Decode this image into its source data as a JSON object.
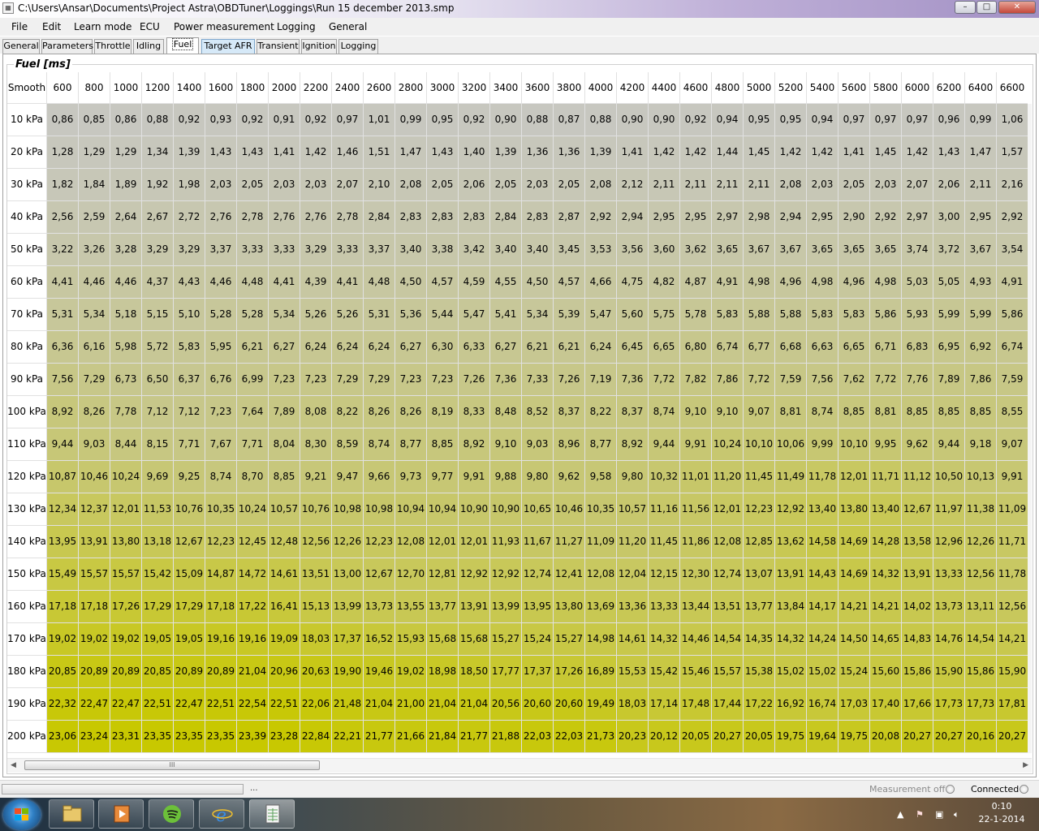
{
  "window": {
    "title": "C:\\Users\\Ansar\\Documents\\Project Astra\\OBDTuner\\Loggings\\Run 15 december 2013.smp",
    "min": "–",
    "max": "□",
    "close": "✕"
  },
  "menu": [
    "File",
    "Edit",
    "Learn mode",
    "ECU",
    "Power measurement",
    "Logging",
    "General"
  ],
  "tabs": [
    "General",
    "Parameters",
    "Throttle",
    "Idling",
    "Fuel",
    "Target AFR",
    "Transient",
    "Ignition",
    "Logging"
  ],
  "active_tab": "Fuel",
  "panel": {
    "title": "Fuel [ms]"
  },
  "table": {
    "corner": "Smooth",
    "columns": [
      "600",
      "800",
      "1000",
      "1200",
      "1400",
      "1600",
      "1800",
      "2000",
      "2200",
      "2400",
      "2600",
      "2800",
      "3000",
      "3200",
      "3400",
      "3600",
      "3800",
      "4000",
      "4200",
      "4400",
      "4600",
      "4800",
      "5000",
      "5200",
      "5400",
      "5600",
      "5800",
      "6000",
      "6200",
      "6400",
      "6600"
    ],
    "rows": [
      {
        "label": "10 kPa",
        "values": [
          "0,86",
          "0,85",
          "0,86",
          "0,88",
          "0,92",
          "0,93",
          "0,92",
          "0,91",
          "0,92",
          "0,97",
          "1,01",
          "0,99",
          "0,95",
          "0,92",
          "0,90",
          "0,88",
          "0,87",
          "0,88",
          "0,90",
          "0,90",
          "0,92",
          "0,94",
          "0,95",
          "0,95",
          "0,94",
          "0,97",
          "0,97",
          "0,97",
          "0,96",
          "0,99",
          "1,06"
        ]
      },
      {
        "label": "20 kPa",
        "values": [
          "1,28",
          "1,29",
          "1,29",
          "1,34",
          "1,39",
          "1,43",
          "1,43",
          "1,41",
          "1,42",
          "1,46",
          "1,51",
          "1,47",
          "1,43",
          "1,40",
          "1,39",
          "1,36",
          "1,36",
          "1,39",
          "1,41",
          "1,42",
          "1,42",
          "1,44",
          "1,45",
          "1,42",
          "1,42",
          "1,41",
          "1,45",
          "1,42",
          "1,43",
          "1,47",
          "1,57"
        ]
      },
      {
        "label": "30 kPa",
        "values": [
          "1,82",
          "1,84",
          "1,89",
          "1,92",
          "1,98",
          "2,03",
          "2,05",
          "2,03",
          "2,03",
          "2,07",
          "2,10",
          "2,08",
          "2,05",
          "2,06",
          "2,05",
          "2,03",
          "2,05",
          "2,08",
          "2,12",
          "2,11",
          "2,11",
          "2,11",
          "2,11",
          "2,08",
          "2,03",
          "2,05",
          "2,03",
          "2,07",
          "2,06",
          "2,11",
          "2,16"
        ]
      },
      {
        "label": "40 kPa",
        "values": [
          "2,56",
          "2,59",
          "2,64",
          "2,67",
          "2,72",
          "2,76",
          "2,78",
          "2,76",
          "2,76",
          "2,78",
          "2,84",
          "2,83",
          "2,83",
          "2,83",
          "2,84",
          "2,83",
          "2,87",
          "2,92",
          "2,94",
          "2,95",
          "2,95",
          "2,97",
          "2,98",
          "2,94",
          "2,95",
          "2,90",
          "2,92",
          "2,97",
          "3,00",
          "2,95",
          "2,92"
        ]
      },
      {
        "label": "50 kPa",
        "values": [
          "3,22",
          "3,26",
          "3,28",
          "3,29",
          "3,29",
          "3,37",
          "3,33",
          "3,33",
          "3,29",
          "3,33",
          "3,37",
          "3,40",
          "3,38",
          "3,42",
          "3,40",
          "3,40",
          "3,45",
          "3,53",
          "3,56",
          "3,60",
          "3,62",
          "3,65",
          "3,67",
          "3,67",
          "3,65",
          "3,65",
          "3,65",
          "3,74",
          "3,72",
          "3,67",
          "3,54"
        ]
      },
      {
        "label": "60 kPa",
        "values": [
          "4,41",
          "4,46",
          "4,46",
          "4,37",
          "4,43",
          "4,46",
          "4,48",
          "4,41",
          "4,39",
          "4,41",
          "4,48",
          "4,50",
          "4,57",
          "4,59",
          "4,55",
          "4,50",
          "4,57",
          "4,66",
          "4,75",
          "4,82",
          "4,87",
          "4,91",
          "4,98",
          "4,96",
          "4,98",
          "4,96",
          "4,98",
          "5,03",
          "5,05",
          "4,93",
          "4,91"
        ]
      },
      {
        "label": "70 kPa",
        "values": [
          "5,31",
          "5,34",
          "5,18",
          "5,15",
          "5,10",
          "5,28",
          "5,28",
          "5,34",
          "5,26",
          "5,26",
          "5,31",
          "5,36",
          "5,44",
          "5,47",
          "5,41",
          "5,34",
          "5,39",
          "5,47",
          "5,60",
          "5,75",
          "5,78",
          "5,83",
          "5,88",
          "5,88",
          "5,83",
          "5,83",
          "5,86",
          "5,93",
          "5,99",
          "5,99",
          "5,86"
        ]
      },
      {
        "label": "80 kPa",
        "values": [
          "6,36",
          "6,16",
          "5,98",
          "5,72",
          "5,83",
          "5,95",
          "6,21",
          "6,27",
          "6,24",
          "6,24",
          "6,24",
          "6,27",
          "6,30",
          "6,33",
          "6,27",
          "6,21",
          "6,21",
          "6,24",
          "6,45",
          "6,65",
          "6,80",
          "6,74",
          "6,77",
          "6,68",
          "6,63",
          "6,65",
          "6,71",
          "6,83",
          "6,95",
          "6,92",
          "6,74"
        ]
      },
      {
        "label": "90 kPa",
        "values": [
          "7,56",
          "7,29",
          "6,73",
          "6,50",
          "6,37",
          "6,76",
          "6,99",
          "7,23",
          "7,23",
          "7,29",
          "7,29",
          "7,23",
          "7,23",
          "7,26",
          "7,36",
          "7,33",
          "7,26",
          "7,19",
          "7,36",
          "7,72",
          "7,82",
          "7,86",
          "7,72",
          "7,59",
          "7,56",
          "7,62",
          "7,72",
          "7,76",
          "7,89",
          "7,86",
          "7,59"
        ]
      },
      {
        "label": "100 kPa",
        "values": [
          "8,92",
          "8,26",
          "7,78",
          "7,12",
          "7,12",
          "7,23",
          "7,64",
          "7,89",
          "8,08",
          "8,22",
          "8,26",
          "8,26",
          "8,19",
          "8,33",
          "8,48",
          "8,52",
          "8,37",
          "8,22",
          "8,37",
          "8,74",
          "9,10",
          "9,10",
          "9,07",
          "8,81",
          "8,74",
          "8,85",
          "8,81",
          "8,85",
          "8,85",
          "8,85",
          "8,55"
        ]
      },
      {
        "label": "110 kPa",
        "values": [
          "9,44",
          "9,03",
          "8,44",
          "8,15",
          "7,71",
          "7,67",
          "7,71",
          "8,04",
          "8,30",
          "8,59",
          "8,74",
          "8,77",
          "8,85",
          "8,92",
          "9,10",
          "9,03",
          "8,96",
          "8,77",
          "8,92",
          "9,44",
          "9,91",
          "10,24",
          "10,10",
          "10,06",
          "9,99",
          "10,10",
          "9,95",
          "9,62",
          "9,44",
          "9,18",
          "9,07"
        ]
      },
      {
        "label": "120 kPa",
        "values": [
          "10,87",
          "10,46",
          "10,24",
          "9,69",
          "9,25",
          "8,74",
          "8,70",
          "8,85",
          "9,21",
          "9,47",
          "9,66",
          "9,73",
          "9,77",
          "9,91",
          "9,88",
          "9,80",
          "9,62",
          "9,58",
          "9,80",
          "10,32",
          "11,01",
          "11,20",
          "11,45",
          "11,49",
          "11,78",
          "12,01",
          "11,71",
          "11,12",
          "10,50",
          "10,13",
          "9,91"
        ]
      },
      {
        "label": "130 kPa",
        "values": [
          "12,34",
          "12,37",
          "12,01",
          "11,53",
          "10,76",
          "10,35",
          "10,24",
          "10,57",
          "10,76",
          "10,98",
          "10,98",
          "10,94",
          "10,94",
          "10,90",
          "10,90",
          "10,65",
          "10,46",
          "10,35",
          "10,57",
          "11,16",
          "11,56",
          "12,01",
          "12,23",
          "12,92",
          "13,40",
          "13,80",
          "13,40",
          "12,67",
          "11,97",
          "11,38",
          "11,09"
        ]
      },
      {
        "label": "140 kPa",
        "values": [
          "13,95",
          "13,91",
          "13,80",
          "13,18",
          "12,67",
          "12,23",
          "12,45",
          "12,48",
          "12,56",
          "12,26",
          "12,23",
          "12,08",
          "12,01",
          "12,01",
          "11,93",
          "11,67",
          "11,27",
          "11,09",
          "11,20",
          "11,45",
          "11,86",
          "12,08",
          "12,85",
          "13,62",
          "14,58",
          "14,69",
          "14,28",
          "13,58",
          "12,96",
          "12,26",
          "11,71"
        ]
      },
      {
        "label": "150 kPa",
        "values": [
          "15,49",
          "15,57",
          "15,57",
          "15,42",
          "15,09",
          "14,87",
          "14,72",
          "14,61",
          "13,51",
          "13,00",
          "12,67",
          "12,70",
          "12,81",
          "12,92",
          "12,92",
          "12,74",
          "12,41",
          "12,08",
          "12,04",
          "12,15",
          "12,30",
          "12,74",
          "13,07",
          "13,91",
          "14,43",
          "14,69",
          "14,32",
          "13,91",
          "13,33",
          "12,56",
          "11,78"
        ]
      },
      {
        "label": "160 kPa",
        "values": [
          "17,18",
          "17,18",
          "17,26",
          "17,29",
          "17,29",
          "17,18",
          "17,22",
          "16,41",
          "15,13",
          "13,99",
          "13,73",
          "13,55",
          "13,77",
          "13,91",
          "13,99",
          "13,95",
          "13,80",
          "13,69",
          "13,36",
          "13,33",
          "13,44",
          "13,51",
          "13,77",
          "13,84",
          "14,17",
          "14,21",
          "14,21",
          "14,02",
          "13,73",
          "13,11",
          "12,56"
        ]
      },
      {
        "label": "170 kPa",
        "values": [
          "19,02",
          "19,02",
          "19,02",
          "19,05",
          "19,05",
          "19,16",
          "19,16",
          "19,09",
          "18,03",
          "17,37",
          "16,52",
          "15,93",
          "15,68",
          "15,68",
          "15,27",
          "15,24",
          "15,27",
          "14,98",
          "14,61",
          "14,32",
          "14,46",
          "14,54",
          "14,35",
          "14,32",
          "14,24",
          "14,50",
          "14,65",
          "14,83",
          "14,76",
          "14,54",
          "14,21"
        ]
      },
      {
        "label": "180 kPa",
        "values": [
          "20,85",
          "20,89",
          "20,89",
          "20,85",
          "20,89",
          "20,89",
          "21,04",
          "20,96",
          "20,63",
          "19,90",
          "19,46",
          "19,02",
          "18,98",
          "18,50",
          "17,77",
          "17,37",
          "17,26",
          "16,89",
          "15,53",
          "15,42",
          "15,46",
          "15,57",
          "15,38",
          "15,02",
          "15,02",
          "15,24",
          "15,60",
          "15,86",
          "15,90",
          "15,86",
          "15,90"
        ]
      },
      {
        "label": "190 kPa",
        "values": [
          "22,32",
          "22,47",
          "22,47",
          "22,51",
          "22,47",
          "22,51",
          "22,54",
          "22,51",
          "22,06",
          "21,48",
          "21,04",
          "21,00",
          "21,04",
          "21,04",
          "20,56",
          "20,60",
          "20,60",
          "19,49",
          "18,03",
          "17,14",
          "17,48",
          "17,44",
          "17,22",
          "16,92",
          "16,74",
          "17,03",
          "17,40",
          "17,66",
          "17,73",
          "17,73",
          "17,81"
        ]
      },
      {
        "label": "200 kPa",
        "values": [
          "23,06",
          "23,24",
          "23,31",
          "23,35",
          "23,35",
          "23,35",
          "23,39",
          "23,28",
          "22,84",
          "22,21",
          "21,77",
          "21,66",
          "21,84",
          "21,77",
          "21,88",
          "22,03",
          "22,03",
          "21,73",
          "20,23",
          "20,12",
          "20,05",
          "20,27",
          "20,05",
          "19,75",
          "19,64",
          "19,75",
          "20,08",
          "20,27",
          "20,27",
          "20,16",
          "20,27"
        ]
      }
    ]
  },
  "scrollbar": {
    "grip": "III"
  },
  "status": {
    "dots": "...",
    "measurement": "Measurement off",
    "connection": "Connected"
  },
  "taskbar": {
    "apps": [
      "windows-explorer",
      "media-player",
      "spotify",
      "internet-explorer",
      "spreadsheet-app"
    ],
    "time": "0:10",
    "date": "22-1-2014"
  },
  "colors": {
    "cell_low": "#c7c7c7",
    "cell_high": "#c8c800",
    "title_gradient_end": "#a290c4"
  }
}
